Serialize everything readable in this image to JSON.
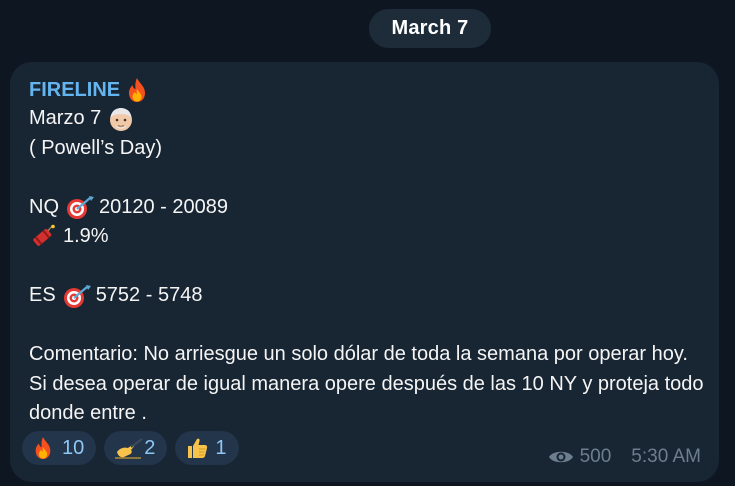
{
  "date_separator": "March 7",
  "message": {
    "sender": "FIRELINE",
    "sender_icon": "fire-icon",
    "lines": {
      "date": "Marzo 7",
      "date_icon": "old-man-icon",
      "subtitle": "( Powell’s Day)",
      "nq_label": "NQ",
      "nq_icon": "target-icon",
      "nq_range": "20120 - 20089",
      "risk_icon": "dynamite-icon",
      "risk_value": "1.9%",
      "es_label": "ES",
      "es_icon": "target-icon",
      "es_range": "5752 - 5748",
      "comment": "Comentario: No arriesgue un solo dólar de toda la semana por operar hoy. Si desea operar de igual manera opere después de las 10 NY y proteja todo donde entre ."
    },
    "reactions": [
      {
        "icon": "fire-icon",
        "count": "10"
      },
      {
        "icon": "writing-hand-icon",
        "count": "2"
      },
      {
        "icon": "thumbs-up-icon",
        "count": "1"
      }
    ],
    "views": "500",
    "views_icon": "eye-icon",
    "time": "5:30 AM"
  },
  "colors": {
    "background": "#0e1621",
    "bubble": "#182533",
    "sender_name": "#64b5ef",
    "reaction_count": "#8cc7f5",
    "meta_text": "#6d7f8f"
  }
}
